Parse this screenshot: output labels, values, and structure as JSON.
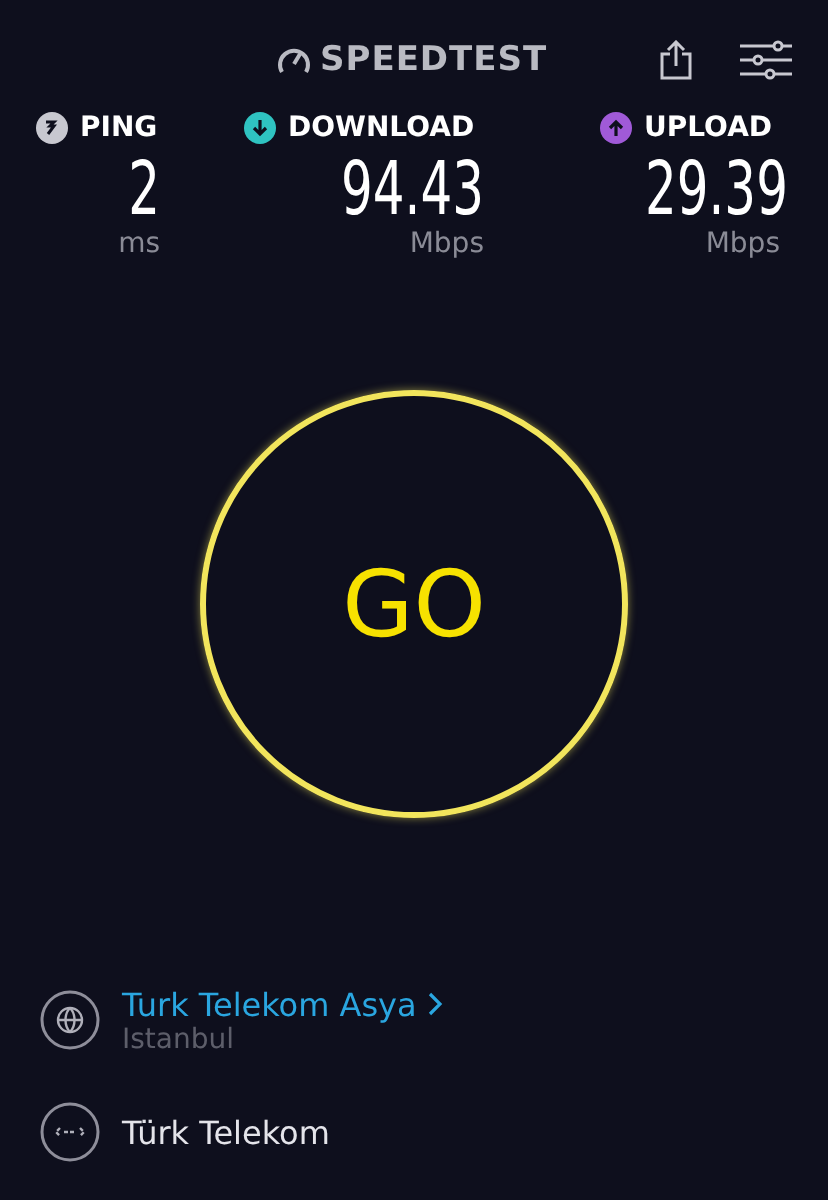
{
  "header": {
    "logo": "SPEEDTEST"
  },
  "metrics": [
    {
      "kind": "ping",
      "label": "PING",
      "value": "2",
      "unit": "ms",
      "color": "#c8c8d0"
    },
    {
      "kind": "download",
      "label": "DOWNLOAD",
      "value": "94.43",
      "unit": "Mbps",
      "color": "#2fc3c1"
    },
    {
      "kind": "upload",
      "label": "UPLOAD",
      "value": "29.39",
      "unit": "Mbps",
      "color": "#a05ad8"
    }
  ],
  "go_button": {
    "label": "GO"
  },
  "connections": [
    {
      "kind": "server",
      "name": "Turk Telekom Asya",
      "location": "Istanbul"
    },
    {
      "kind": "provider",
      "name": "Türk Telekom"
    }
  ]
}
